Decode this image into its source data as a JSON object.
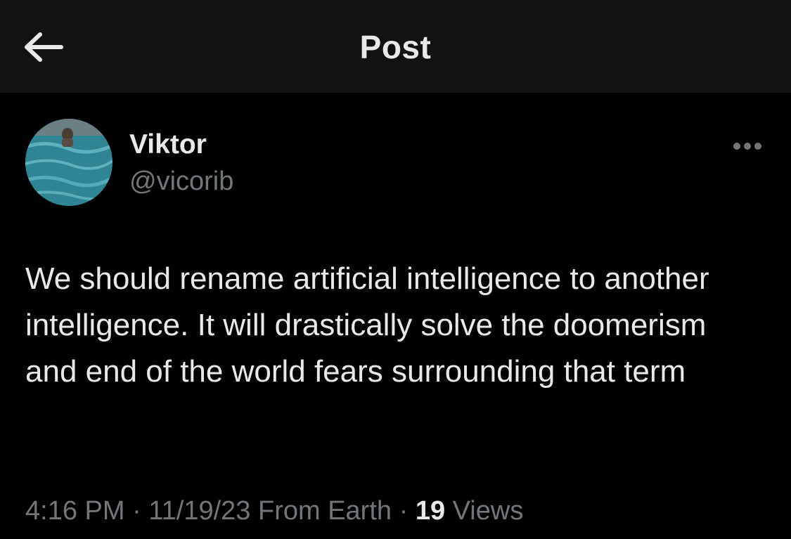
{
  "header": {
    "title": "Post",
    "back_icon": "arrow-left-icon"
  },
  "author": {
    "name": "Viktor",
    "handle": "@vicorib",
    "avatar_colors": [
      "#4aa6b4",
      "#2e7f8f",
      "#1f5a66"
    ]
  },
  "post": {
    "text": "We should rename artificial intelligence to another intelligence. It will drastically solve the doomerism and end of the world fears surrounding that term"
  },
  "meta": {
    "time": "4:16 PM",
    "separator": " · ",
    "date": "11/19/23",
    "location": " From Earth",
    "views_count": "19",
    "views_label": " Views"
  },
  "colors": {
    "background": "#000000",
    "header_background": "#121212",
    "primary_text": "#e7e9ea",
    "secondary_text": "#71767b"
  }
}
